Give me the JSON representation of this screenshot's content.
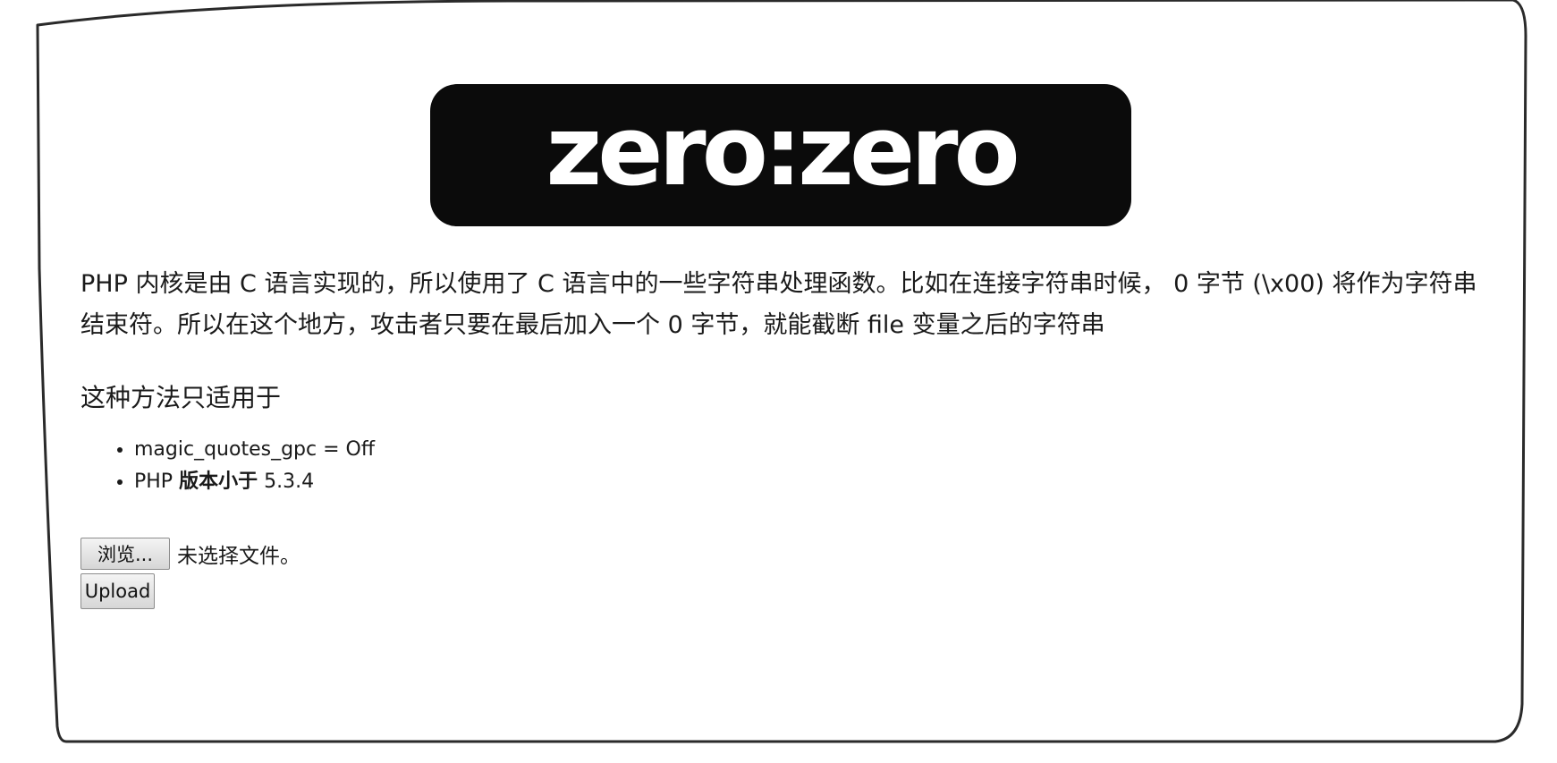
{
  "logo": {
    "text": "zero:zero"
  },
  "intro": "PHP 内核是由 C 语言实现的，所以使用了 C 语言中的一些字符串处理函数。比如在连接字符串时候， 0 字节 (\\x00) 将作为字符串结束符。所以在这个地方，攻击者只要在最后加入一个 0 字节，就能截断 file 变量之后的字符串",
  "subtitle": "这种方法只适用于",
  "requirements": [
    {
      "text": "magic_quotes_gpc = Off"
    },
    {
      "prefix": "PHP ",
      "bold": "版本小于",
      "suffix": " 5.3.4"
    }
  ],
  "form": {
    "browse_label": "浏览...",
    "file_status": "未选择文件。",
    "upload_label": "Upload"
  }
}
